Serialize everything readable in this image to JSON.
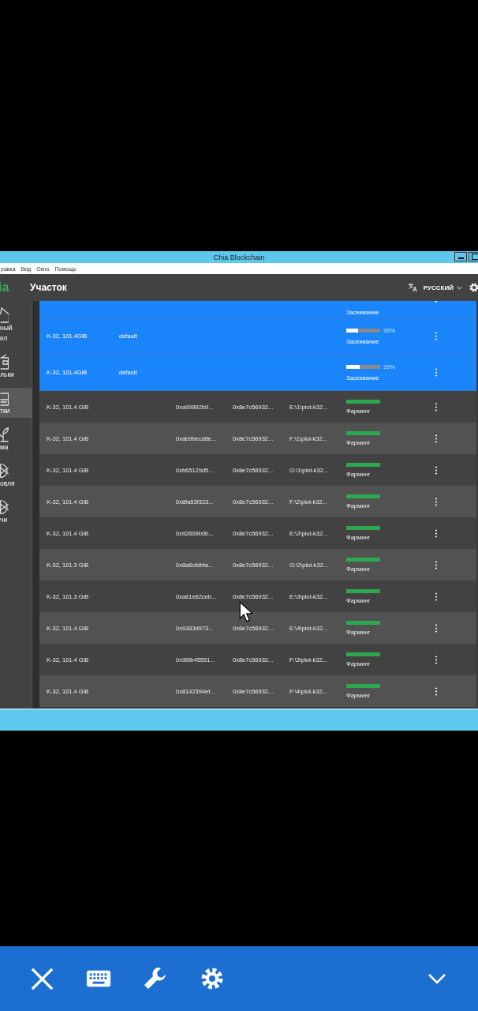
{
  "window": {
    "title": "Chia Blockchain"
  },
  "menu": [
    "равка",
    "Вид",
    "Окно",
    "Помощь"
  ],
  "header": {
    "logo": "ia",
    "title": "Участок",
    "language": "РУССКИЙ"
  },
  "sidebar": {
    "items": [
      {
        "label": "ный ел",
        "selected": false
      },
      {
        "label": "льки",
        "selected": false
      },
      {
        "label": "тки",
        "selected": true
      },
      {
        "label": "ма",
        "selected": false
      },
      {
        "label": "овля",
        "selected": false
      },
      {
        "label": "чи",
        "selected": false
      }
    ]
  },
  "plots": [
    {
      "kind": "plotting_cut",
      "status": "Засеивание"
    },
    {
      "kind": "plotting",
      "size": "K-32, 101.4GiB",
      "queue": "default",
      "level": 0.36,
      "reading": "36%",
      "status": "Засеивание"
    },
    {
      "kind": "plotting",
      "size": "K-32, 101.4GiB",
      "queue": "default",
      "level": 0.39,
      "reading": "39%",
      "status": "Засеивание"
    },
    {
      "kind": "farming",
      "size": "K-32, 101.4 GiB",
      "key": "0xa99892b9...",
      "pool_key": "0x8e7c56932...",
      "file": "E:\\1\\plot-k32...",
      "status": "Фарминг"
    },
    {
      "kind": "farming",
      "size": "K-32, 101.4 GiB",
      "key": "0xab9becd8e...",
      "pool_key": "0x8e7c56932...",
      "file": "F:\\1\\plot-k32...",
      "status": "Фарминг"
    },
    {
      "kind": "farming",
      "size": "K-32, 101.4 GiB",
      "key": "0xb65129d5...",
      "pool_key": "0x8e7c56932...",
      "file": "G:\\1\\plot-k32...",
      "status": "Фарминг"
    },
    {
      "kind": "farming",
      "size": "K-32, 101.4 GiB",
      "key": "0x8fa53f323...",
      "pool_key": "0x8e7c56932...",
      "file": "F:\\2\\plot-k32...",
      "status": "Фарминг"
    },
    {
      "kind": "farming",
      "size": "K-32, 101.4 GiB",
      "key": "0x92609b0b...",
      "pool_key": "0x8e7c56932...",
      "file": "E:\\2\\plot-k32...",
      "status": "Фарминг"
    },
    {
      "kind": "farming",
      "size": "K-32, 101.3 GiB",
      "key": "0x8a6cfdbfa...",
      "pool_key": "0x8e7c56932...",
      "file": "G:\\2\\plot-k32...",
      "status": "Фарминг"
    },
    {
      "kind": "farming",
      "size": "K-32, 101.3 GiB",
      "key": "0xa81e62ceb...",
      "pool_key": "0x8e7c56932...",
      "file": "E:\\3\\plot-k32...",
      "status": "Фарминг"
    },
    {
      "kind": "farming",
      "size": "K-32, 101.4 GiB",
      "key": "0x9383d973...",
      "pool_key": "0x8e7c56932...",
      "file": "E:\\4\\plot-k32...",
      "status": "Фарминг"
    },
    {
      "kind": "farming",
      "size": "K-32, 101.4 GiB",
      "key": "0x96fb45551...",
      "pool_key": "0x8e7c56932...",
      "file": "F:\\3\\plot-k32...",
      "status": "Фарминг"
    },
    {
      "kind": "farming",
      "size": "K-32, 101.4 GiB",
      "key": "0x8142394ef...",
      "pool_key": "0x8e7c56932...",
      "file": "F:\\4\\plot-k32...",
      "status": "Фарминг"
    }
  ]
}
